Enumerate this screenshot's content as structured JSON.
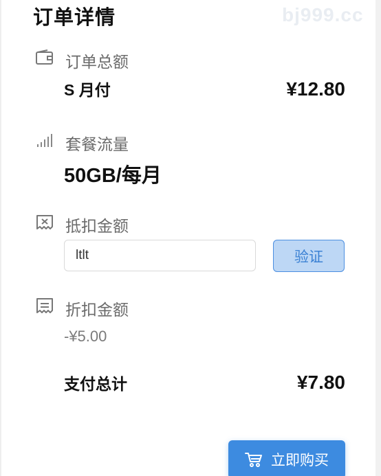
{
  "header": {
    "title": "订单详情",
    "watermark": "bj999.cc"
  },
  "order_total": {
    "icon": "wallet-icon",
    "label": "订单总额",
    "plan_name": "S 月付",
    "price": "¥12.80"
  },
  "traffic": {
    "icon": "signal-bars-icon",
    "label": "套餐流量",
    "value": "50GB/每月"
  },
  "deduction": {
    "icon": "coupon-icon",
    "label": "抵扣金额",
    "input_value": "ltlt",
    "verify_label": "验证"
  },
  "discount": {
    "icon": "receipt-icon",
    "label": "折扣金额",
    "value": "-¥5.00"
  },
  "summary": {
    "total_label": "支付总计",
    "total_value": "¥7.80"
  },
  "actions": {
    "buy_icon": "cart-icon",
    "buy_label": "立即购买"
  },
  "colors": {
    "accent": "#3d8be0",
    "verify_bg": "#bdd7f5",
    "verify_text": "#3c82d4",
    "muted_text": "#6b6b6b"
  }
}
